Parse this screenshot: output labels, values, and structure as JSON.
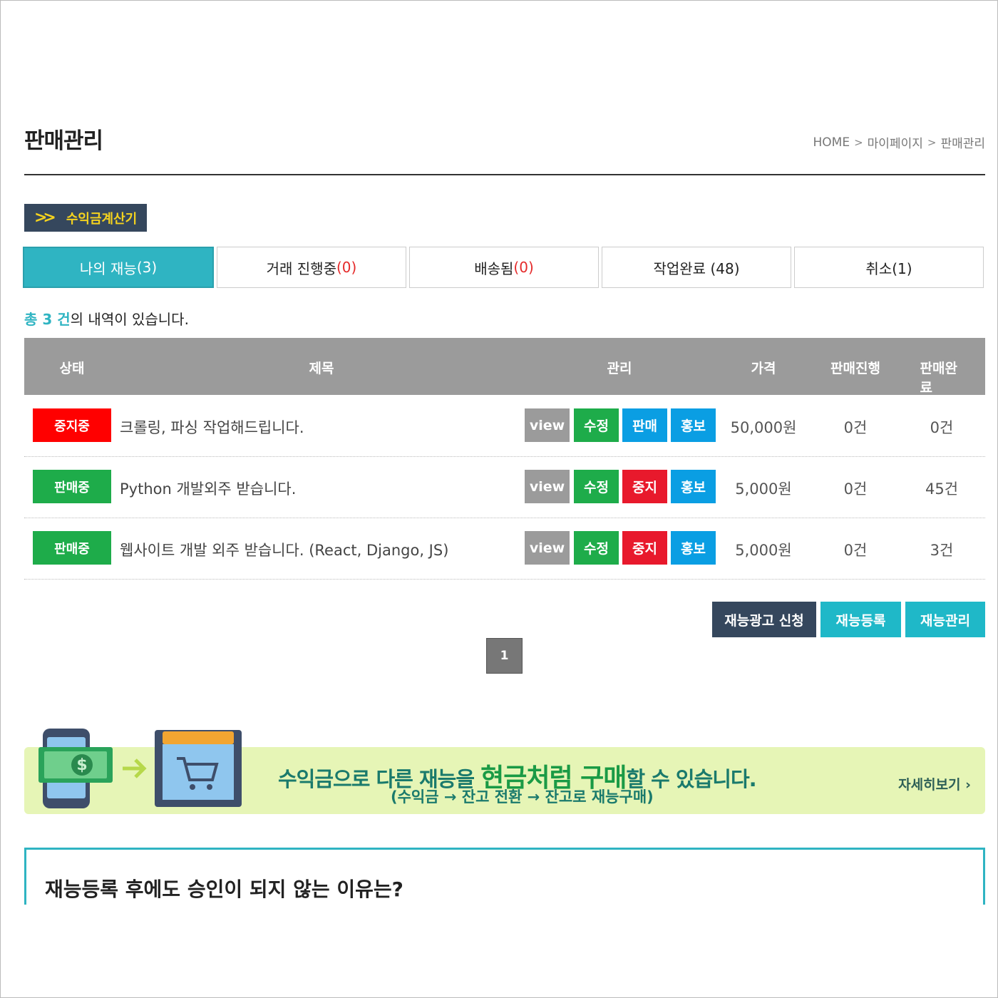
{
  "header": {
    "title": "판매관리",
    "breadcrumb": [
      "HOME",
      "마이페이지",
      "판매관리"
    ]
  },
  "calculator_button": "수익금계산기",
  "tabs": [
    {
      "label": "나의 재능 ",
      "count": "(3)",
      "active": true
    },
    {
      "label": "거래 진행중 ",
      "count": "(0)",
      "active": false
    },
    {
      "label": "배송됨 ",
      "count": "(0)",
      "active": false
    },
    {
      "label": "작업완료 (48)",
      "count": "",
      "active": false
    },
    {
      "label": "취소(1)",
      "count": "",
      "active": false
    }
  ],
  "summary": {
    "highlight": "총 3 건",
    "rest": "의 내역이 있습니다."
  },
  "table": {
    "headers": [
      "상태",
      "제목",
      "관리",
      "가격",
      "판매진행",
      "판매완료"
    ],
    "rows": [
      {
        "status": "중지중",
        "title": "크롤링, 파싱 작업해드립니다.",
        "view": "view",
        "edit": "수정",
        "toggle": "판매",
        "promo": "홍보",
        "price": "50,000원",
        "in_progress": "0건",
        "completed": "0건"
      },
      {
        "status": "판매중",
        "title": "Python 개발외주 받습니다.",
        "view": "view",
        "edit": "수정",
        "toggle": "중지",
        "promo": "홍보",
        "price": "5,000원",
        "in_progress": "0건",
        "completed": "45건"
      },
      {
        "status": "판매중",
        "title": "웹사이트 개발 외주 받습니다. (React, Django, JS)",
        "view": "view",
        "edit": "수정",
        "toggle": "중지",
        "promo": "홍보",
        "price": "5,000원",
        "in_progress": "0건",
        "completed": "3건"
      }
    ]
  },
  "actions": {
    "ad": "재능광고 신청",
    "register": "재능등록",
    "manage": "재능관리"
  },
  "pagination": {
    "current": "1"
  },
  "banner": {
    "main_prefix": "수익금으로 다른 재능을 ",
    "main_big": "현금처럼 구매",
    "main_suffix": "할 수 있습니다.",
    "sub": "(수익금 → 잔고 전환 → 잔고로 재능구매)",
    "more": "자세히보기 ›"
  },
  "faq": {
    "title": "재능등록 후에도 승인이 되지 않는 이유는?"
  },
  "colors": {
    "accent": "#2fb4c2",
    "navy": "#35475d",
    "stop": "#ff0000",
    "sale": "#1eac4a",
    "blue": "#0a9ee3"
  }
}
